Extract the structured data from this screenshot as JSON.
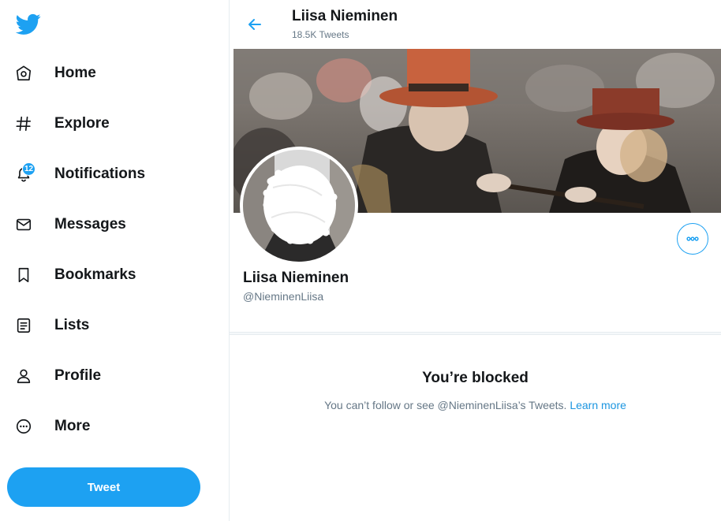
{
  "colors": {
    "brand": "#1da1f2",
    "text": "#14171a",
    "muted": "#657786",
    "link": "#1b95e0"
  },
  "sidebar": {
    "logo_icon": "twitter-bird-icon",
    "items": [
      {
        "label": "Home",
        "icon": "home-icon"
      },
      {
        "label": "Explore",
        "icon": "hashtag-icon"
      },
      {
        "label": "Notifications",
        "icon": "bell-icon",
        "badge": "12"
      },
      {
        "label": "Messages",
        "icon": "envelope-icon"
      },
      {
        "label": "Bookmarks",
        "icon": "bookmark-icon"
      },
      {
        "label": "Lists",
        "icon": "list-icon"
      },
      {
        "label": "Profile",
        "icon": "person-icon"
      },
      {
        "label": "More",
        "icon": "more-circle-icon"
      }
    ],
    "tweet_button": "Tweet"
  },
  "header": {
    "name": "Liisa Nieminen",
    "tweet_count": "18.5K Tweets"
  },
  "profile": {
    "name": "Liisa Nieminen",
    "handle": "@NieminenLiisa"
  },
  "blocked": {
    "title": "You’re blocked",
    "message": "You can’t follow or see @NieminenLiisa’s Tweets.",
    "link": "Learn more"
  }
}
